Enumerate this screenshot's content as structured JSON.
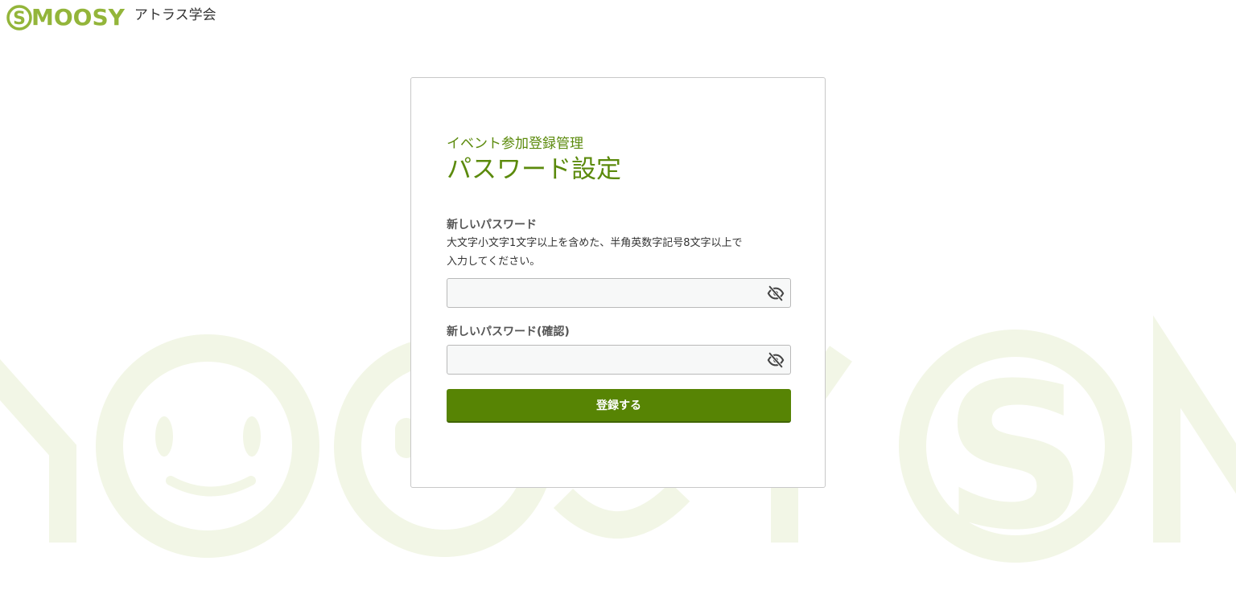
{
  "header": {
    "logo_text": "MOOSY",
    "logo_mark_letter": "S",
    "org_name": "アトラス学会"
  },
  "card": {
    "subtitle": "イベント参加登録管理",
    "title": "パスワード設定",
    "new_password": {
      "label": "新しいパスワード",
      "hint_line1": "大文字小文字1文字以上を含めた、半角英数字記号8文字以上で",
      "hint_line2": "入力してください。",
      "value": "",
      "toggle_icon": "eye-slash-icon"
    },
    "confirm_password": {
      "label": "新しいパスワード(確認)",
      "value": "",
      "toggle_icon": "eye-slash-icon"
    },
    "submit_label": "登録する"
  },
  "colors": {
    "brand_green": "#93b53a",
    "title_green": "#5b8a0c",
    "button_green": "#578404",
    "watermark": "#f2f6e6"
  }
}
